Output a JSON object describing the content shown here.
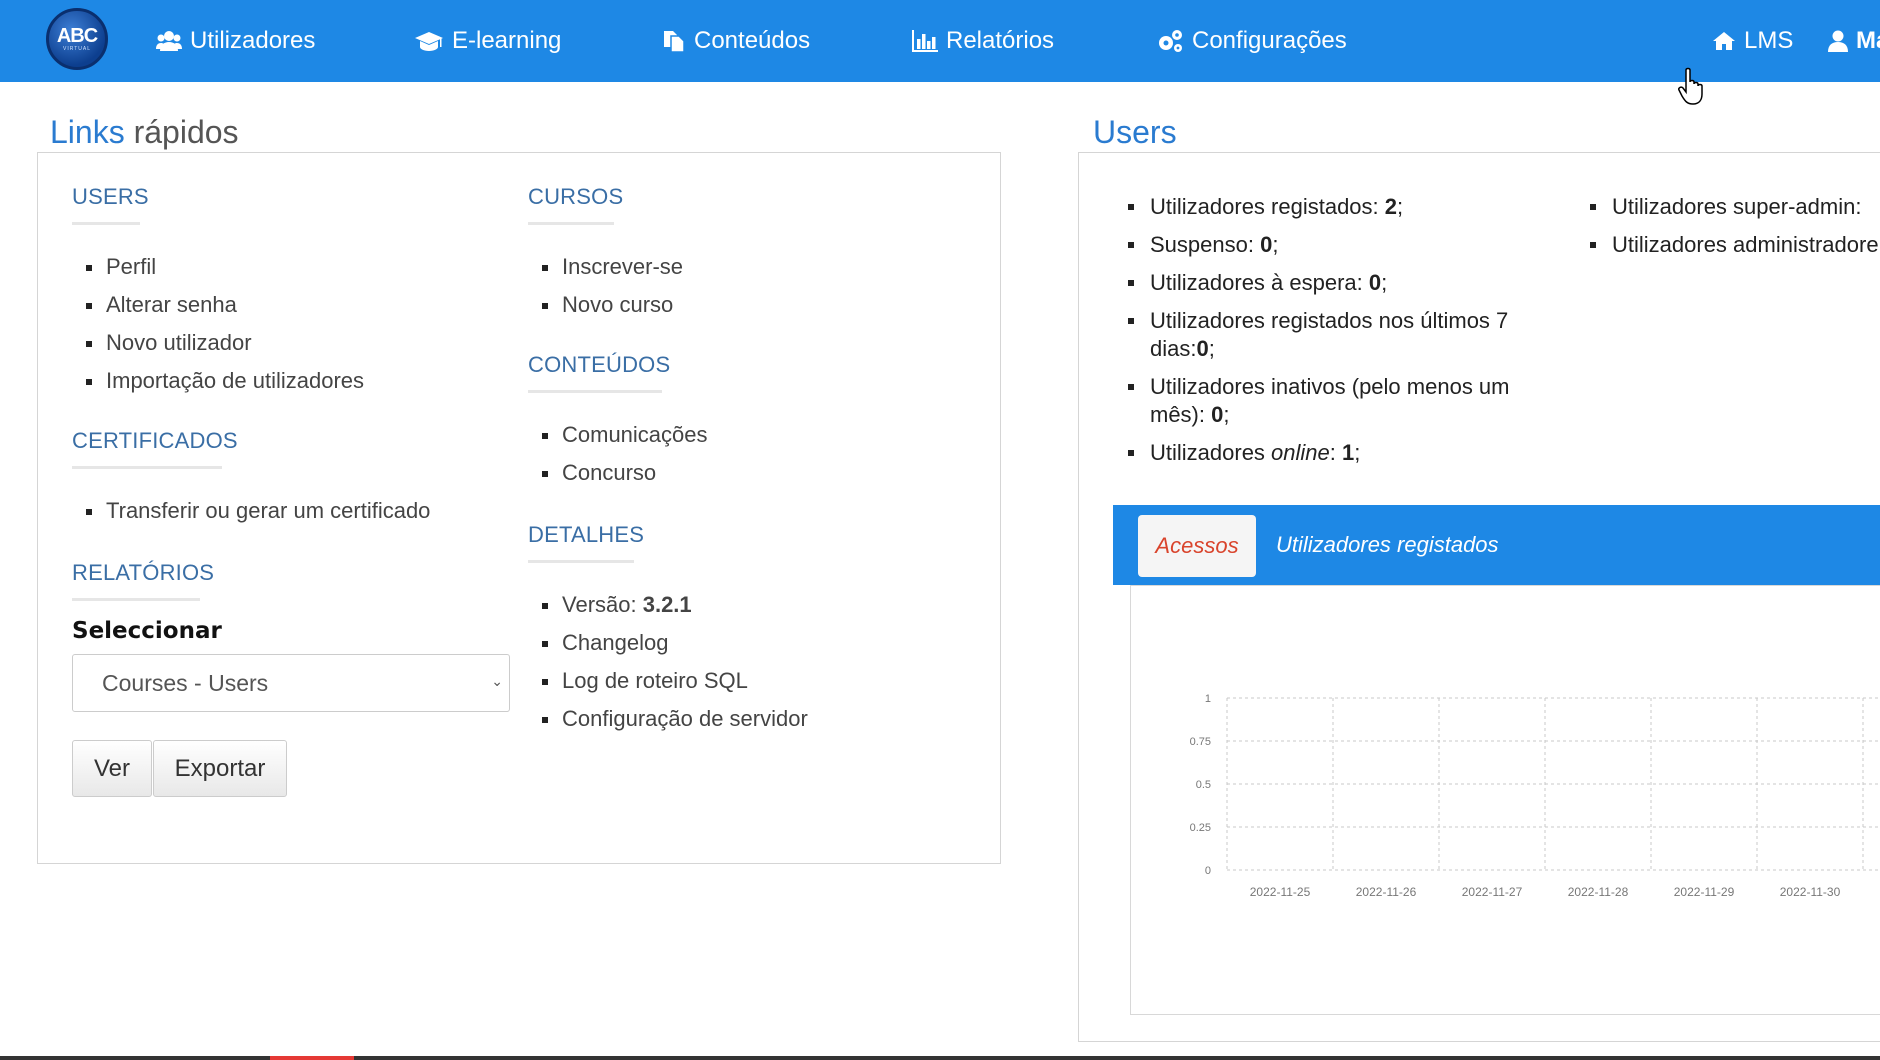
{
  "nav": {
    "logo_text": "ABC",
    "logo_sub": "VIRTUAL",
    "items": [
      {
        "label": "Utilizadores",
        "icon": "users-icon"
      },
      {
        "label": "E-learning",
        "icon": "graduation-cap-icon"
      },
      {
        "label": "Conteúdos",
        "icon": "files-icon"
      },
      {
        "label": "Relatórios",
        "icon": "bar-chart-icon"
      },
      {
        "label": "Configurações",
        "icon": "gears-icon"
      }
    ],
    "lms": {
      "label": "LMS",
      "icon": "home-icon"
    },
    "user": {
      "label": "Ma",
      "icon": "user-icon"
    }
  },
  "quick_links": {
    "title_a": "Links",
    "title_b": " rápidos",
    "users": {
      "heading": "USERS",
      "items": [
        "Perfil",
        "Alterar senha",
        "Novo utilizador",
        "Importação de utilizadores"
      ]
    },
    "certificados": {
      "heading": "CERTIFICADOS",
      "items": [
        "Transferir ou gerar um certificado"
      ]
    },
    "relatorios": {
      "heading": "RELATÓRIOS",
      "select_label": "Seleccionar",
      "select_value": "Courses - Users",
      "view_button": "Ver",
      "export_button": "Exportar"
    },
    "cursos": {
      "heading": "CURSOS",
      "items": [
        "Inscrever-se",
        "Novo curso"
      ]
    },
    "conteudos": {
      "heading": "CONTEÚDOS",
      "items": [
        "Comunicações",
        "Concurso"
      ]
    },
    "detalhes": {
      "heading": "DETALHES",
      "version_label": "Versão: ",
      "version_value": "3.2.1",
      "items": [
        "Changelog",
        "Log de roteiro SQL",
        "Configuração de servidor"
      ]
    }
  },
  "users": {
    "title": "Users",
    "stats": [
      {
        "label": "Utilizadores registados: ",
        "value": "2",
        "suffix": ";"
      },
      {
        "label": "Suspenso: ",
        "value": "0",
        "suffix": ";"
      },
      {
        "label": "Utilizadores à espera: ",
        "value": "0",
        "suffix": ";"
      },
      {
        "label": "Utilizadores registados nos últimos 7 dias:",
        "value": "0",
        "suffix": ";"
      },
      {
        "label": "Utilizadores inativos (pelo menos um mês): ",
        "value": "0",
        "suffix": ";"
      },
      {
        "label_pre": "Utilizadores ",
        "label_em": "online",
        "label": ": ",
        "value": "1",
        "suffix": ";"
      }
    ],
    "stats_right": [
      "Utilizadores super-admin: ",
      "Utilizadores administradore"
    ],
    "tabs": {
      "active": "Acessos",
      "other": "Utilizadores registados"
    }
  },
  "colors": {
    "nav_bg": "#1e88e5",
    "accent_blue": "#2a7bd0",
    "active_tab_text": "#d9442c"
  },
  "chart_data": {
    "type": "line",
    "x": [
      "2022-11-25",
      "2022-11-26",
      "2022-11-27",
      "2022-11-28",
      "2022-11-29",
      "2022-11-30"
    ],
    "yticks": [
      "1",
      "0.75",
      "0.5",
      "0.25",
      "0"
    ],
    "ylim": [
      0,
      1
    ],
    "grid": true,
    "series": []
  }
}
